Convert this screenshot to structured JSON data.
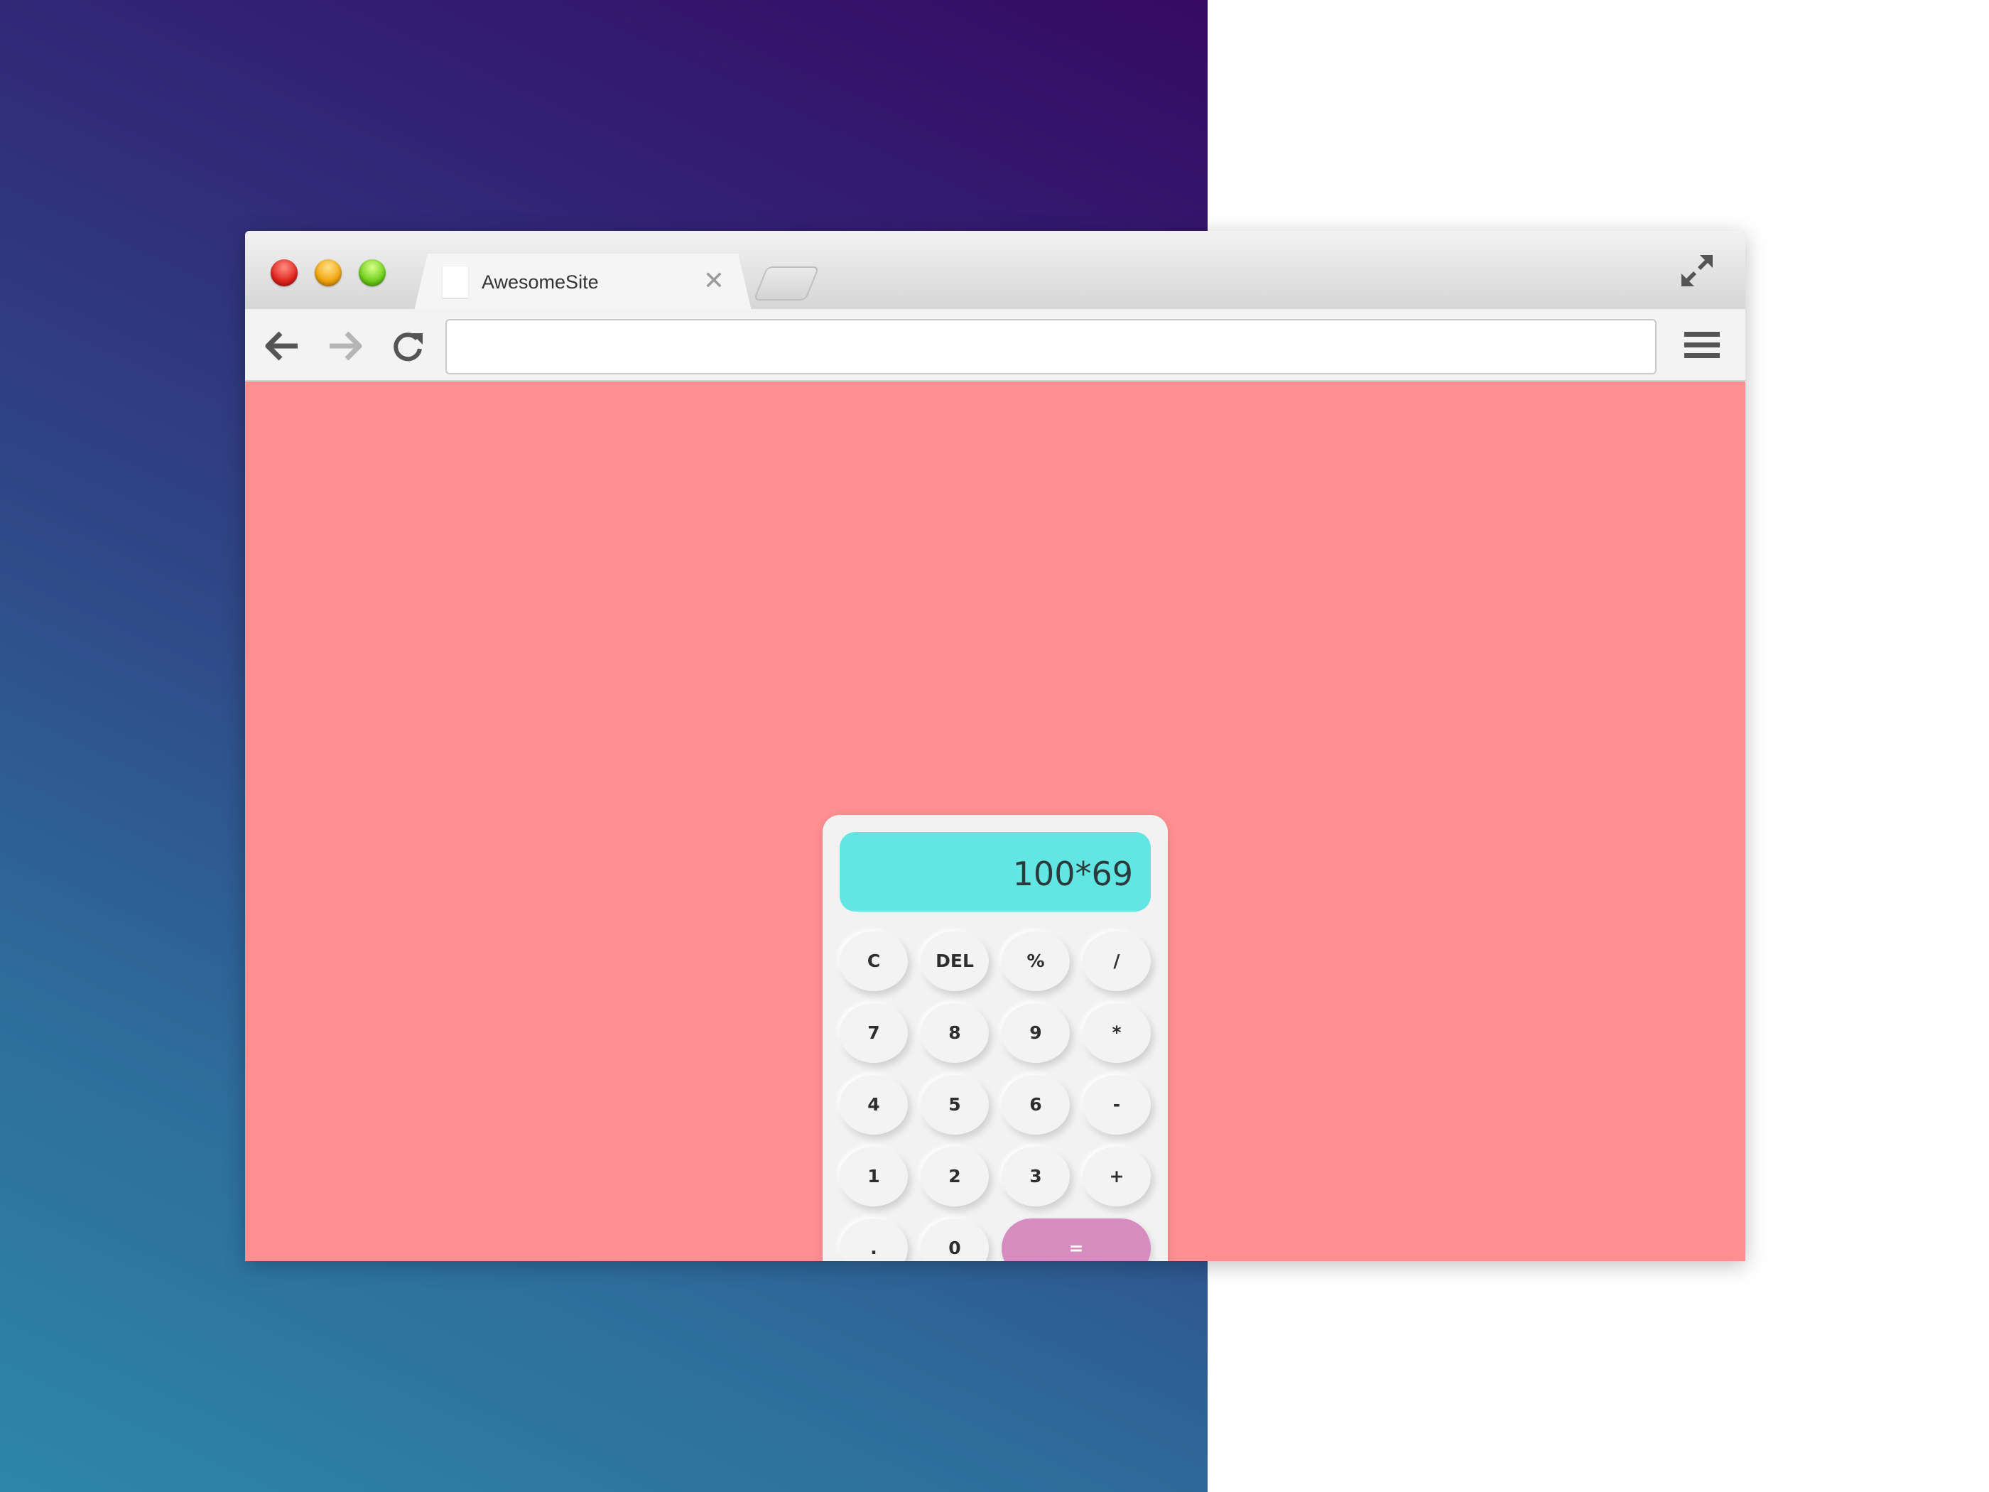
{
  "browser": {
    "tab": {
      "title": "AwesomeSite",
      "close_glyph": "✕"
    },
    "address_bar": {
      "value": "",
      "placeholder": ""
    },
    "icons": [
      "close-window-icon",
      "minimize-window-icon",
      "zoom-window-icon",
      "favicon-icon",
      "new-tab-icon",
      "expand-icon",
      "back-arrow-icon",
      "forward-arrow-icon",
      "reload-icon",
      "hamburger-menu-icon"
    ]
  },
  "colors": {
    "page_background": "#ff8f91",
    "display": "#61e6e3",
    "equals_key": "#d78cc0",
    "calculator_body": "#f2f2f2"
  },
  "calculator": {
    "display": "100*69",
    "keys": [
      {
        "label": "C",
        "name": "key-clear"
      },
      {
        "label": "DEL",
        "name": "key-delete"
      },
      {
        "label": "%",
        "name": "key-percent"
      },
      {
        "label": "/",
        "name": "key-divide"
      },
      {
        "label": "7",
        "name": "key-7"
      },
      {
        "label": "8",
        "name": "key-8"
      },
      {
        "label": "9",
        "name": "key-9"
      },
      {
        "label": "*",
        "name": "key-multiply"
      },
      {
        "label": "4",
        "name": "key-4"
      },
      {
        "label": "5",
        "name": "key-5"
      },
      {
        "label": "6",
        "name": "key-6"
      },
      {
        "label": "-",
        "name": "key-subtract"
      },
      {
        "label": "1",
        "name": "key-1"
      },
      {
        "label": "2",
        "name": "key-2"
      },
      {
        "label": "3",
        "name": "key-3"
      },
      {
        "label": "+",
        "name": "key-add"
      },
      {
        "label": ".",
        "name": "key-decimal"
      },
      {
        "label": "0",
        "name": "key-0"
      },
      {
        "label": "=",
        "name": "key-equals"
      }
    ]
  }
}
